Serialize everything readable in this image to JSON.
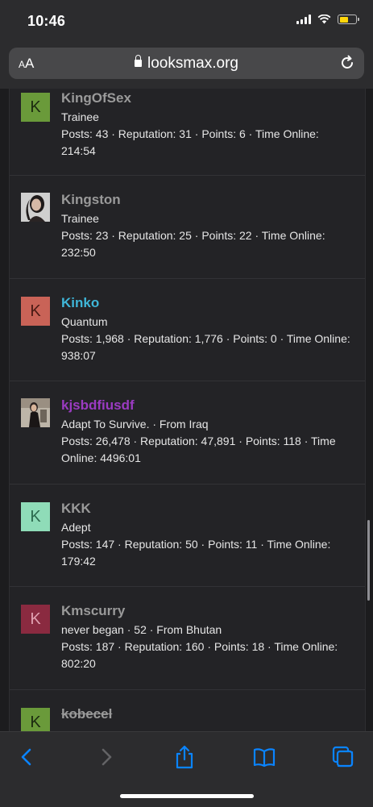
{
  "status_bar": {
    "time": "10:46"
  },
  "browser": {
    "text_size_label": "AA",
    "url": "looksmax.org"
  },
  "members": [
    {
      "name": "KingOfSex",
      "name_color": "#9a9a9a",
      "strike": false,
      "avatar_letter": "K",
      "avatar_bg": "#6a9a3a",
      "avatar_fg": "#1b2a10",
      "title": "Trainee",
      "stats": "Posts: 43 · Reputation: 31 · Points: 6 · Time Online: 214:54"
    },
    {
      "name": "Kingston",
      "name_color": "#9a9a9a",
      "strike": false,
      "avatar_letter": "",
      "avatar_photo": true,
      "title": "Trainee",
      "stats": "Posts: 23 · Reputation: 25 · Points: 22 · Time Online: 232:50"
    },
    {
      "name": "Kinko",
      "name_color": "#3fb6d8",
      "strike": false,
      "avatar_letter": "K",
      "avatar_bg": "#c96357",
      "avatar_fg": "#4a1a14",
      "title": "Quantum",
      "stats": "Posts: 1,968 · Reputation: 1,776 · Points: 0 · Time Online: 938:07"
    },
    {
      "name": "kjsbdfiusdf",
      "name_color": "#9b3bc2",
      "strike": false,
      "avatar_letter": "",
      "avatar_photo": true,
      "title": "Adapt To Survive. · From Iraq",
      "stats": "Posts: 26,478 · Reputation: 47,891 · Points: 118 · Time Online: 4496:01"
    },
    {
      "name": "KKK",
      "name_color": "#9a9a9a",
      "strike": false,
      "avatar_letter": "K",
      "avatar_bg": "#8fdcb8",
      "avatar_fg": "#2c6a4e",
      "title": "Adept",
      "stats": "Posts: 147 · Reputation: 50 · Points: 11 · Time Online: 179:42"
    },
    {
      "name": "Kmscurry",
      "name_color": "#9a9a9a",
      "strike": false,
      "avatar_letter": "K",
      "avatar_bg": "#8a2a40",
      "avatar_fg": "#e0a0b0",
      "title": "never began · 52 · From Bhutan",
      "stats": "Posts: 187 · Reputation: 160 · Points: 18 · Time Online: 802:20"
    },
    {
      "name": "kobecel",
      "name_color": "#9a9a9a",
      "strike": true,
      "avatar_letter": "K",
      "avatar_bg": "#6a9a3a",
      "avatar_fg": "#1b2a10",
      "title": "",
      "stats": ""
    }
  ],
  "colors": {
    "accent": "#0a84ff",
    "toolbar_disabled": "#636366"
  },
  "toolbar_icons": [
    "back-icon",
    "forward-icon",
    "share-icon",
    "bookmarks-icon",
    "tabs-icon"
  ]
}
